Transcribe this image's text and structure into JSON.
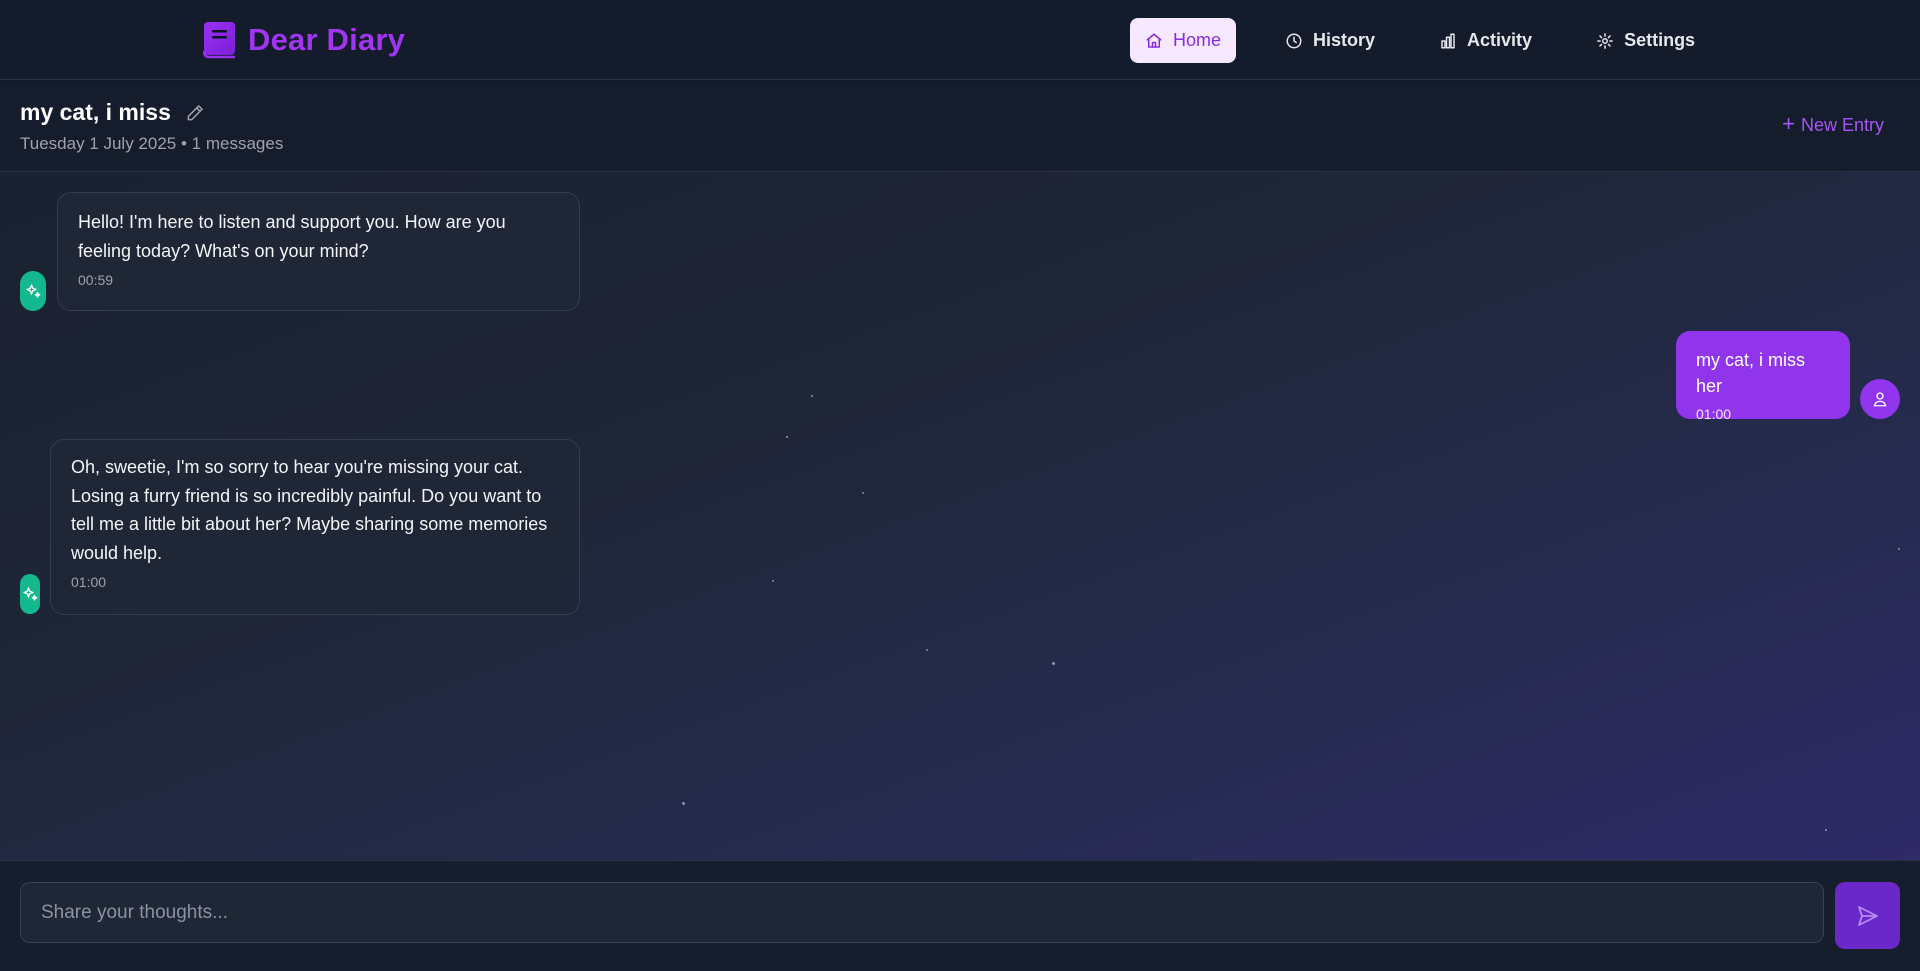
{
  "app": {
    "name": "Dear Diary",
    "brand_color": "#a036f2",
    "logo_icon": "book-icon"
  },
  "nav": {
    "items": [
      {
        "label": "Home",
        "icon": "home-icon",
        "active": true
      },
      {
        "label": "History",
        "icon": "clock-icon",
        "active": false
      },
      {
        "label": "Activity",
        "icon": "bar-chart-icon",
        "active": false
      },
      {
        "label": "Settings",
        "icon": "gear-icon",
        "active": false
      }
    ]
  },
  "entry": {
    "title": "my cat, i miss",
    "date": "Tuesday 1 July 2025",
    "separator": " • ",
    "message_count": "1 messages",
    "new_entry_label": "New Entry"
  },
  "messages": [
    {
      "role": "assistant",
      "text": "Hello! I'm here to listen and support you. How are you feeling today? What's on your mind?",
      "time": "00:59"
    },
    {
      "role": "user",
      "text": "my cat, i miss her",
      "time": "01:00"
    },
    {
      "role": "assistant",
      "text": "Oh, sweetie, I'm so sorry to hear you're missing your cat. Losing a furry friend is so incredibly painful. Do you want to tell me a little bit about her? Maybe sharing some memories would help.",
      "time": "01:00"
    }
  ],
  "composer": {
    "placeholder": "Share your thoughts...",
    "value": "",
    "send_icon": "send-icon"
  },
  "colors": {
    "assistant_avatar": "#14b88f",
    "user_bubble": "#9135ec",
    "send_button": "#6a28c9",
    "active_nav_bg": "#f5e8ff"
  }
}
